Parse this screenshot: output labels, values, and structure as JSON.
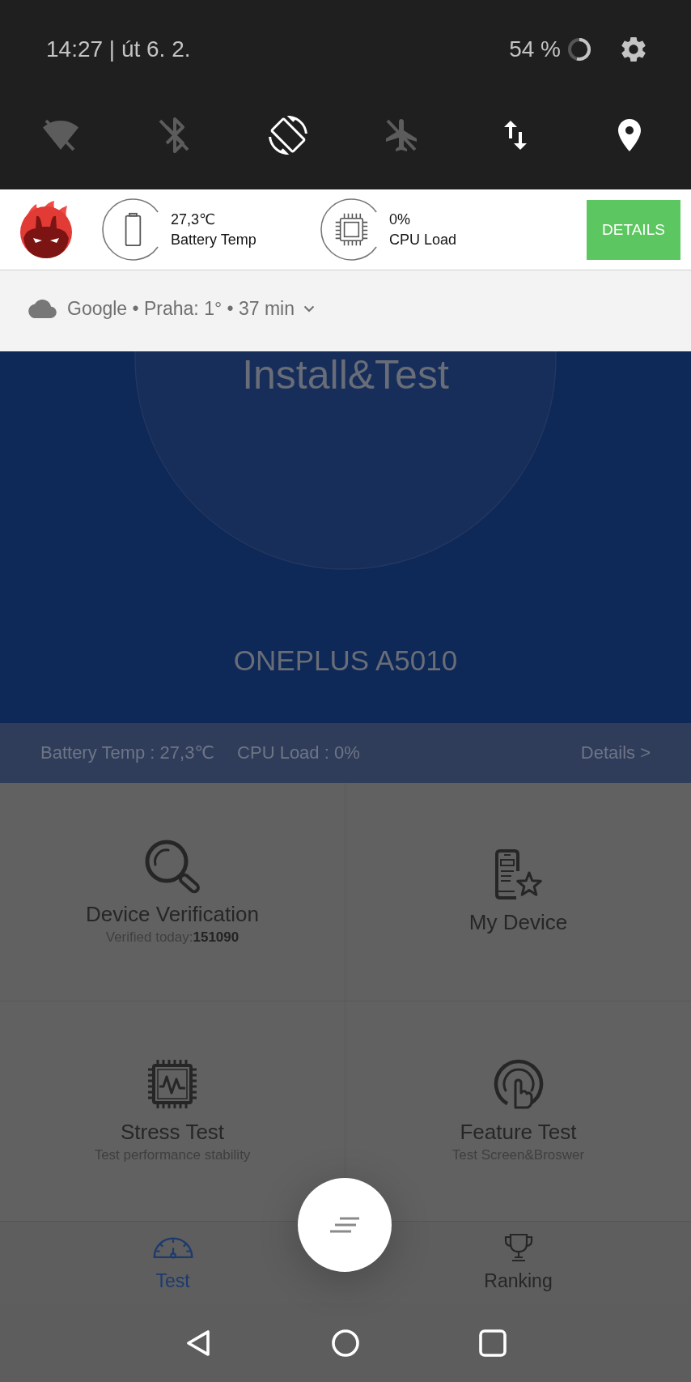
{
  "status_bar": {
    "datetime": "14:27 | út 6. 2.",
    "battery": "54 %"
  },
  "quick_tiles": [
    {
      "kind": "wifi",
      "on": false
    },
    {
      "kind": "bluetooth",
      "on": false
    },
    {
      "kind": "rotate",
      "on": true
    },
    {
      "kind": "airplane",
      "on": false
    },
    {
      "kind": "data",
      "on": true
    },
    {
      "kind": "location",
      "on": true
    }
  ],
  "notification": {
    "stats": [
      {
        "kind": "battery",
        "value": "27,3℃",
        "label": "Battery Temp"
      },
      {
        "kind": "cpu",
        "value": "0%",
        "label": "CPU Load"
      }
    ],
    "button": "DETAILS"
  },
  "weather": {
    "text": "Google • Praha: 1° • 37 min"
  },
  "hero": {
    "title": "Install&Test",
    "device": "ONEPLUS A5010"
  },
  "info_bar": {
    "battery": "Battery Temp : 27,3℃",
    "cpu": "CPU Load : 0%",
    "link": "Details >"
  },
  "tiles": [
    {
      "kind": "verify",
      "title": "Device Verification",
      "subtitle": "Verified today:**151090**"
    },
    {
      "kind": "device",
      "title": "My Device"
    },
    {
      "kind": "stress",
      "title": "Stress Test",
      "subtitle": "Test performance stability"
    },
    {
      "kind": "feature",
      "title": "Feature Test",
      "subtitle": "Test Screen&Broswer"
    }
  ],
  "bottom_nav": {
    "tabs": [
      {
        "kind": "gauge",
        "label": "Test",
        "selected": true
      },
      {
        "kind": "trophy",
        "label": "Ranking",
        "selected": false
      }
    ]
  }
}
